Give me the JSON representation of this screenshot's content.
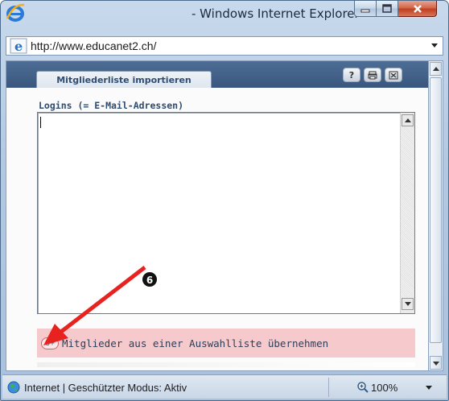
{
  "window": {
    "title": "- Windows Internet Explorer",
    "buttons": [
      "minimize",
      "maximize",
      "close"
    ]
  },
  "address_bar": {
    "url": "http://www.educanet2.ch/"
  },
  "dialog": {
    "tab_label": "Mitgliederliste importieren",
    "header_icons": [
      "help-icon",
      "print-icon",
      "close-icon"
    ],
    "help_glyph": "?",
    "logins_label": "Logins (= E-Mail-Adressen)",
    "textarea_value": "",
    "pick_icon_glyph": "8+",
    "pick_label": "Mitglieder aus einer Auswahlliste übernehmen"
  },
  "status_bar": {
    "zone_text": "Internet | Geschützter Modus: Aktiv",
    "zoom": "100%"
  },
  "annotation": {
    "marker": "6"
  },
  "colors": {
    "dialog_header": "#39577e",
    "tab_text": "#2f4d72",
    "pick_row_bg": "#f6c9cc",
    "annotation_red": "#e8231f"
  }
}
